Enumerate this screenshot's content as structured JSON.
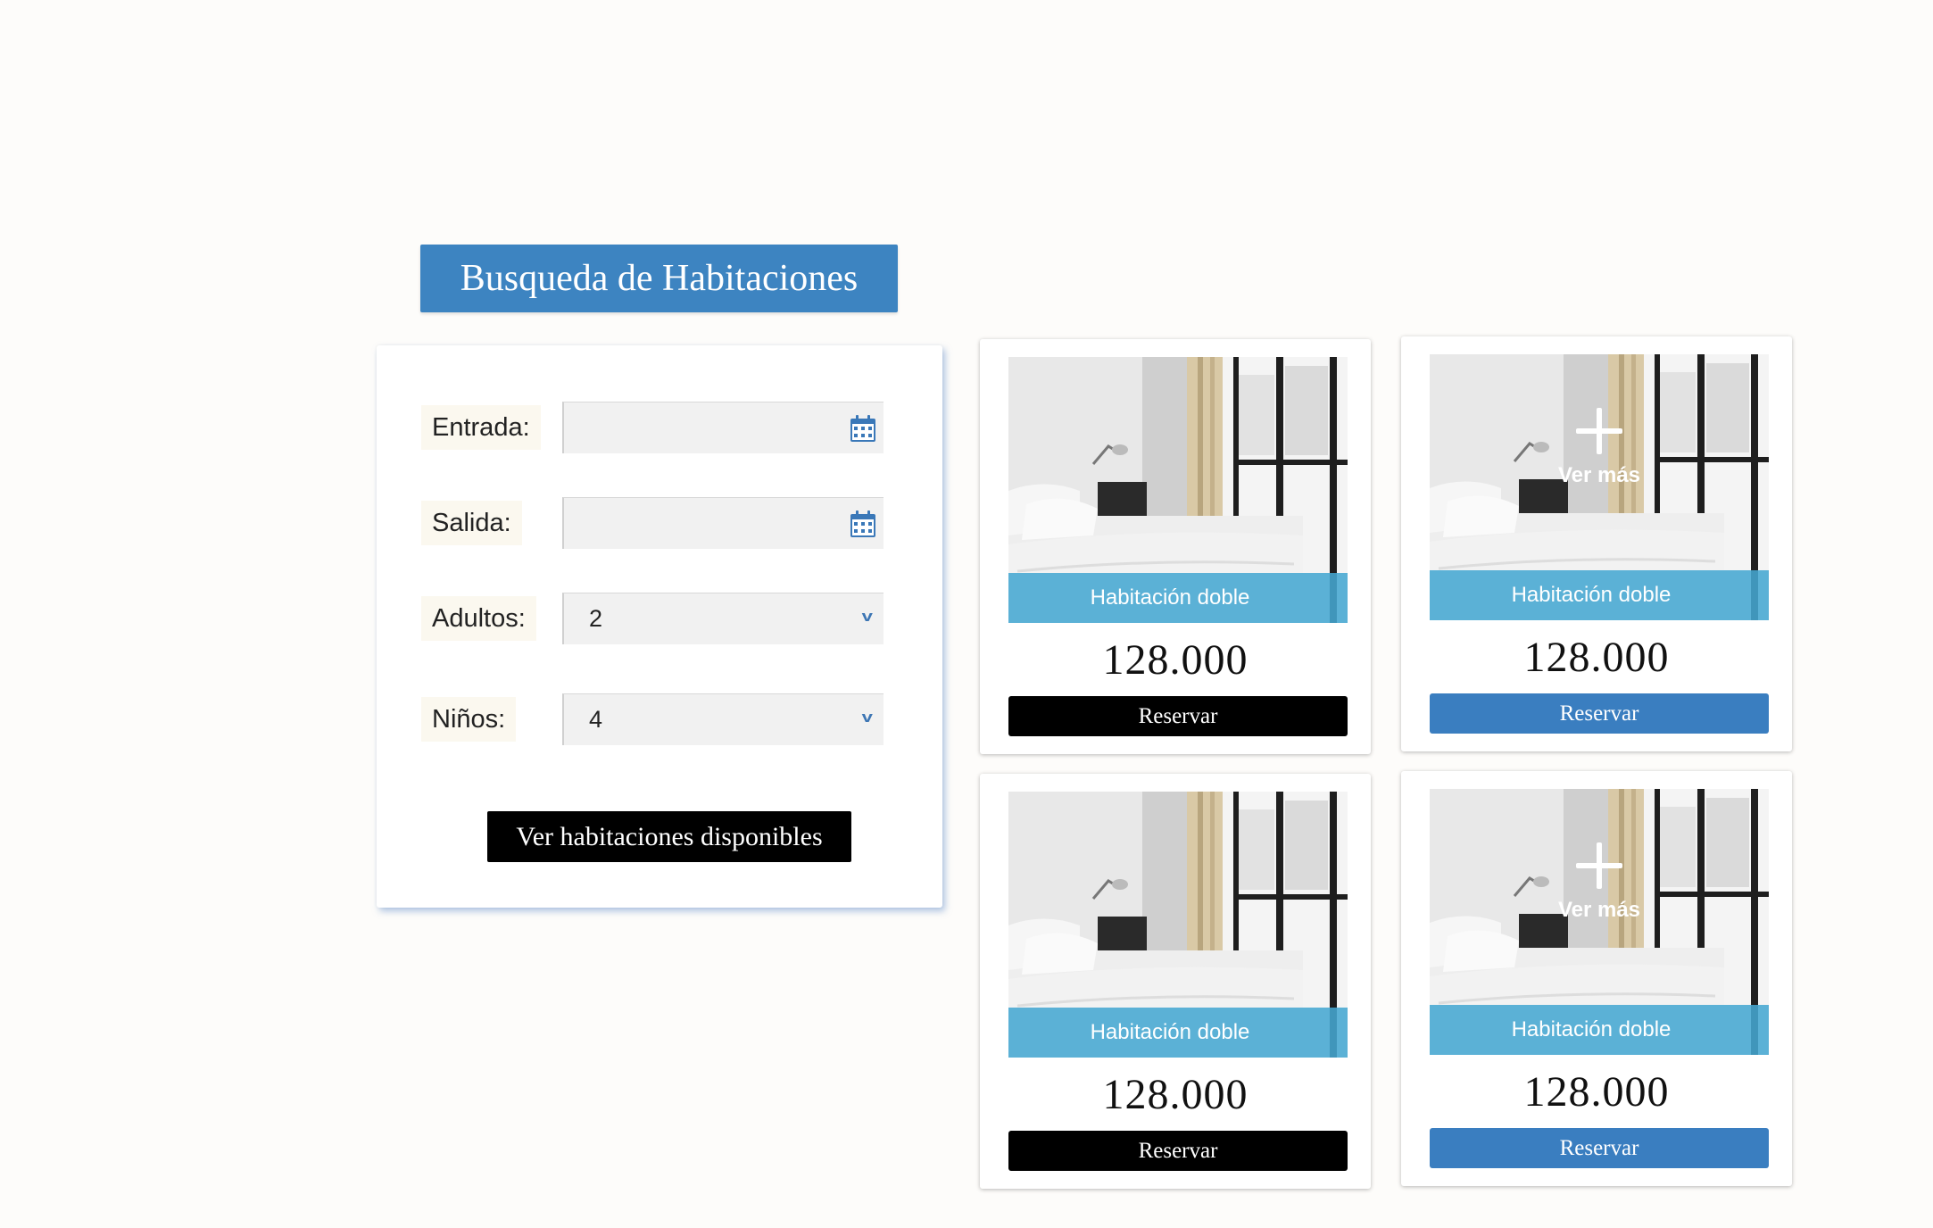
{
  "title": "Busqueda de Habitaciones",
  "search_form": {
    "check_in_label": "Entrada:",
    "check_in_value": "",
    "check_out_label": "Salida:",
    "check_out_value": "",
    "adults_label": "Adultos:",
    "adults_value": "2",
    "children_label": "Niños:",
    "children_value": "4",
    "submit_label": "Ver habitaciones disponibles",
    "calendar_icon": "calendar-icon",
    "dropdown_icon": "chevron-down-icon"
  },
  "rooms": [
    {
      "name": "Habitación doble",
      "price": "128.000",
      "button_label": "Reservar",
      "overlay": "",
      "button_color": "#000000"
    },
    {
      "name": "Habitación doble",
      "price": "128.000",
      "button_label": "Reservar",
      "overlay": "Ver más",
      "button_color": "#3a7ec0"
    },
    {
      "name": "Habitación doble",
      "price": "128.000",
      "button_label": "Reservar",
      "overlay": "",
      "button_color": "#000000"
    },
    {
      "name": "Habitación doble",
      "price": "128.000",
      "button_label": "Reservar",
      "overlay": "Ver más",
      "button_color": "#3a7ec0"
    }
  ],
  "colors": {
    "accent": "#3d84c1",
    "caption_bar": "#45a7d2",
    "background": "#fdfcfa"
  }
}
